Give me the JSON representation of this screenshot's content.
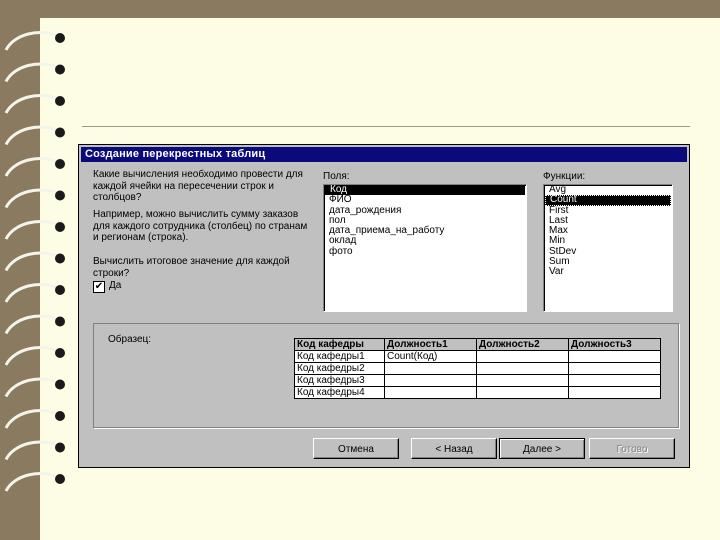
{
  "dialog": {
    "title": "Создание перекрестных таблиц",
    "question1": "Какие вычисления необходимо провести для каждой ячейки на пересечении строк и столбцов?",
    "example": "Например, можно вычислить сумму заказов для каждого сотрудника (столбец) по странам и регионам (строка).",
    "question2": "Вычислить итоговое значение для каждой строки?",
    "checkbox_label": "Да",
    "checkbox_mark": "✔",
    "fields_label": "Поля:",
    "fields": [
      "Код",
      "ФИО",
      "дата_рождения",
      "пол",
      "дата_приема_на_работу",
      "оклад",
      "фото"
    ],
    "functions_label": "Функции:",
    "functions": [
      "Avg",
      "Count",
      "First",
      "Last",
      "Max",
      "Min",
      "StDev",
      "Sum",
      "Var"
    ],
    "sample_label": "Образец:",
    "grid_headers": [
      "Код кафедры",
      "Должность1",
      "Должность2",
      "Должность3"
    ],
    "grid_rows": [
      "Код кафедры1",
      "Код кафедры2",
      "Код кафедры3",
      "Код кафедры4"
    ],
    "grid_cell": "Count(Код)",
    "buttons": {
      "cancel": "Отмена",
      "back": "< Назад",
      "next": "Далее >",
      "finish": "Готово"
    }
  }
}
